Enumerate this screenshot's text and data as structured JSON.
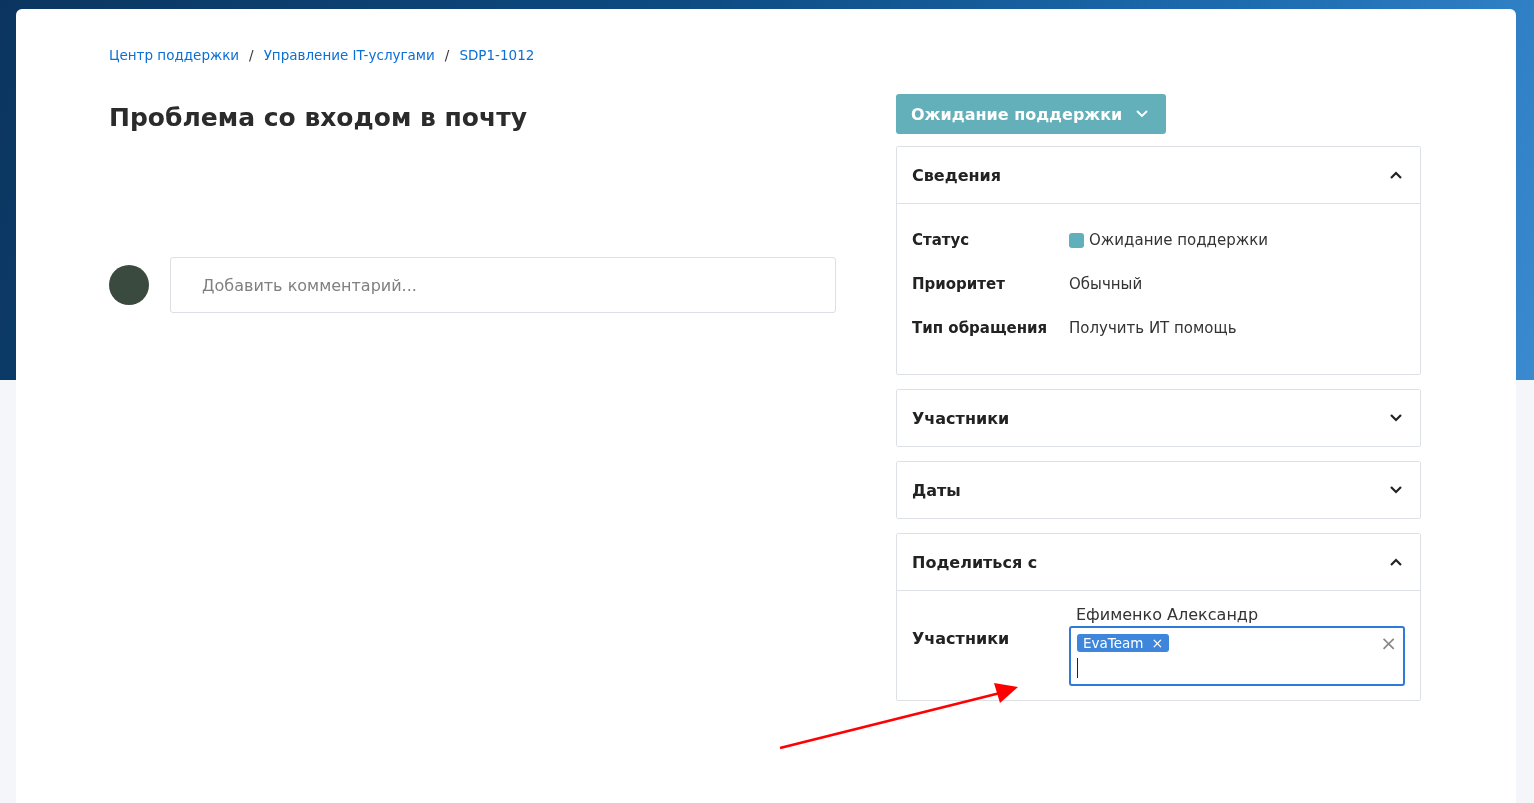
{
  "breadcrumbs": [
    {
      "label": "Центр поддержки"
    },
    {
      "label": "Управление IT-услугами"
    },
    {
      "label": "SDP1-1012"
    }
  ],
  "breadcrumb_separator": "/",
  "title": "Проблема со входом в почту",
  "comment": {
    "placeholder": "Добавить комментарий..."
  },
  "status_button": {
    "label": "Ожидание поддержки"
  },
  "sections": [
    {
      "kind": "details",
      "title": "Сведения",
      "expanded": true,
      "fields": [
        {
          "label": "Статус",
          "value": "Ожидание поддержки",
          "color": "#5fb0bb"
        },
        {
          "label": "Приоритет",
          "value": "Обычный"
        },
        {
          "label": "Тип обращения",
          "value": "Получить ИТ помощь"
        }
      ]
    },
    {
      "title": "Участники",
      "expanded": false
    },
    {
      "title": "Даты",
      "expanded": false
    },
    {
      "kind": "share",
      "title": "Поделиться с",
      "expanded": true,
      "label": "Участники",
      "above": "Ефименко Александр",
      "tags": [
        {
          "label": "EvaTeam",
          "remove": "×"
        }
      ],
      "clear": "×"
    }
  ]
}
